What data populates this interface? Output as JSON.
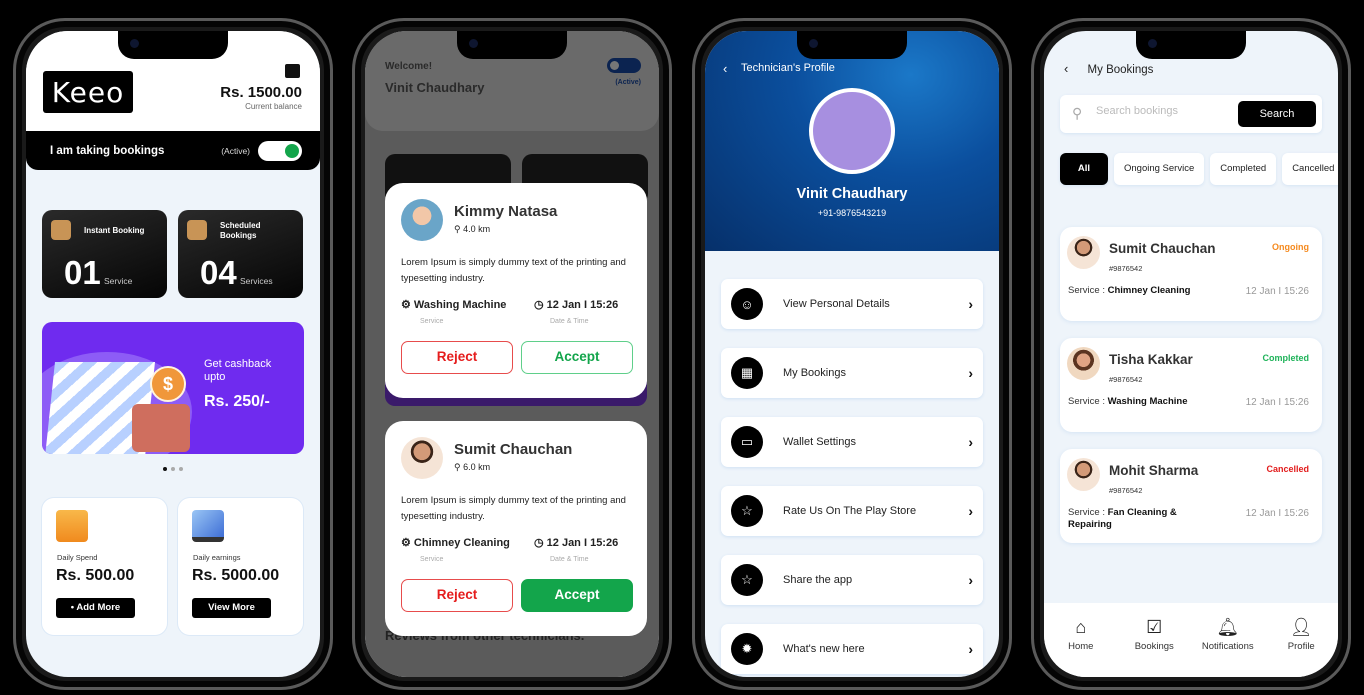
{
  "phone1": {
    "logo_text": "Keeo",
    "balance": "Rs. 1500.00",
    "balance_label": "Current balance",
    "booking_toggle_label": "I am taking bookings",
    "booking_toggle_state": "(Active)",
    "booking_toggle_on": true,
    "stats": [
      {
        "title": "Instant Booking",
        "count": "01",
        "unit": "Service",
        "icon": "package-clock-icon"
      },
      {
        "title": "Scheduled Bookings",
        "count": "04",
        "unit": "Services",
        "icon": "package-calendar-icon"
      }
    ],
    "promo": {
      "line1": "Get cashback upto",
      "amount": "Rs. 250/-",
      "coin": "$"
    },
    "carousel": {
      "pages": 3,
      "active": 1
    },
    "cards": [
      {
        "label": "Daily Spend",
        "value": "Rs. 500.00",
        "button": "• Add More",
        "icon": "wallet-icon"
      },
      {
        "label": "Daily earnings",
        "value": "Rs. 5000.00",
        "button": "View More",
        "icon": "analytics-monitor-icon"
      }
    ]
  },
  "phone2": {
    "welcome": "Welcome!",
    "user_name": "Vinit Chaudhary",
    "toggle_state": "(Active)",
    "background_heading": "Reviews from other technicians.",
    "requests": [
      {
        "name": "Kimmy Natasa",
        "distance": "4.0 km",
        "description": "Lorem Ipsum is simply dummy text of the printing and typesetting industry.",
        "service": "Washing Machine",
        "service_label": "Service",
        "datetime": "12 Jan I 15:26",
        "datetime_label": "Date & Time",
        "reject": "Reject",
        "accept": "Accept"
      },
      {
        "name": "Sumit Chauchan",
        "distance": "6.0 km",
        "description": "Lorem Ipsum is simply dummy text of the printing and typesetting industry.",
        "service": "Chimney Cleaning",
        "service_label": "Service",
        "datetime": "12 Jan I 15:26",
        "datetime_label": "Date & Time",
        "reject": "Reject",
        "accept": "Accept"
      }
    ]
  },
  "phone3": {
    "back": "‹",
    "title": "Technician's Profile",
    "name": "Vinit Chaudhary",
    "phone": "+91-9876543219",
    "menu": [
      {
        "label": "View Personal Details",
        "icon": "user-icon",
        "glyph": "☺"
      },
      {
        "label": "My Bookings",
        "icon": "calendar-icon",
        "glyph": "▦"
      },
      {
        "label": "Wallet Settings",
        "icon": "wallet-icon",
        "glyph": "▭"
      },
      {
        "label": "Rate Us On The Play Store",
        "icon": "star-icon",
        "glyph": "☆"
      },
      {
        "label": "Share the app",
        "icon": "star-icon",
        "glyph": "☆"
      },
      {
        "label": "What's new here",
        "icon": "new-badge-icon",
        "glyph": "✹"
      }
    ],
    "chevron": "›"
  },
  "phone4": {
    "back": "‹",
    "title": "My Bookings",
    "search_placeholder": "Search bookings",
    "search_value": "",
    "search_button": "Search",
    "filters": [
      "All",
      "Ongoing Service",
      "Completed",
      "Cancelled"
    ],
    "active_filter": "All",
    "service_prefix": "Service : ",
    "bookings": [
      {
        "name": "Sumit Chauchan",
        "id": "#9876542",
        "status": "Ongoing",
        "status_color": "#f58a1f",
        "service": "Chimney Cleaning",
        "datetime": "12 Jan I 15:26"
      },
      {
        "name": "Tisha Kakkar",
        "id": "#9876542",
        "status": "Completed",
        "status_color": "#1fb35a",
        "service": "Washing Machine",
        "datetime": "12 Jan I 15:26"
      },
      {
        "name": "Mohit Sharma",
        "id": "#9876542",
        "status": "Cancelled",
        "status_color": "#e21b1b",
        "service": "Fan Cleaning & Repairing",
        "datetime": "12 Jan I 15:26"
      }
    ],
    "tabs": [
      {
        "label": "Home",
        "icon": "home-icon",
        "glyph": "⌂"
      },
      {
        "label": "Bookings",
        "icon": "calendar-check-icon",
        "glyph": "☑"
      },
      {
        "label": "Notifications",
        "icon": "bell-icon",
        "glyph": "🔔︎"
      },
      {
        "label": "Profile",
        "icon": "user-icon",
        "glyph": "👤︎"
      }
    ]
  },
  "colors": {
    "accent_green": "#13a54b",
    "reject_red": "#e51d1d",
    "promo_purple": "#6f2bef",
    "profile_blue": "#0b4f9e"
  }
}
